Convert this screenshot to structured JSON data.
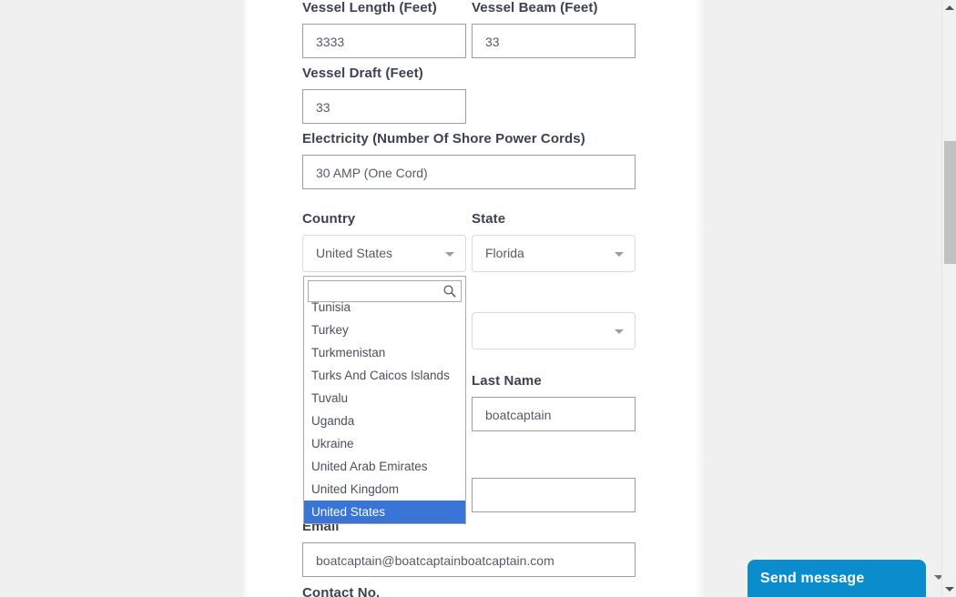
{
  "form": {
    "fields": [
      {
        "label": "Vessel Length (Feet)",
        "value": "3333",
        "type": "text"
      },
      {
        "label": "Vessel Beam (Feet)",
        "value": "33",
        "type": "text"
      },
      {
        "label": "Vessel Draft (Feet)",
        "value": "33",
        "type": "text"
      },
      {
        "label": "Electricity (Number Of Shore Power Cords)",
        "value": "30 AMP (One Cord)",
        "type": "text"
      },
      {
        "label": "Country",
        "value": "United States",
        "type": "select"
      },
      {
        "label": "State",
        "value": "Florida",
        "type": "select"
      },
      {
        "label": "",
        "value": "",
        "type": "select"
      },
      {
        "label": "Last Name",
        "value": "boatcaptain",
        "type": "text"
      },
      {
        "label": "Email",
        "value": "boatcaptain@boatcaptainboatcaptain.com",
        "type": "text"
      },
      {
        "label": "Contact No.",
        "value": "",
        "type": "text"
      }
    ]
  },
  "country_dropdown": {
    "search_value": "",
    "search_placeholder": "",
    "search_icon": "search-icon",
    "options": [
      "Tunisia",
      "Turkey",
      "Turkmenistan",
      "Turks And Caicos Islands",
      "Tuvalu",
      "Uganda",
      "Ukraine",
      "United Arab Emirates",
      "United Kingdom",
      "United States"
    ],
    "selected": "United States",
    "highlight_color": "#3875d7"
  },
  "chat_widget": {
    "label": "Send message",
    "color": "#0b8dcd",
    "chevron_icon": "chevron-down-icon"
  },
  "scrollbar": {
    "up_icon": "scroll-up-arrow-icon",
    "down_icon": "scroll-down-arrow-icon",
    "thumb": "scrollbar-thumb"
  }
}
